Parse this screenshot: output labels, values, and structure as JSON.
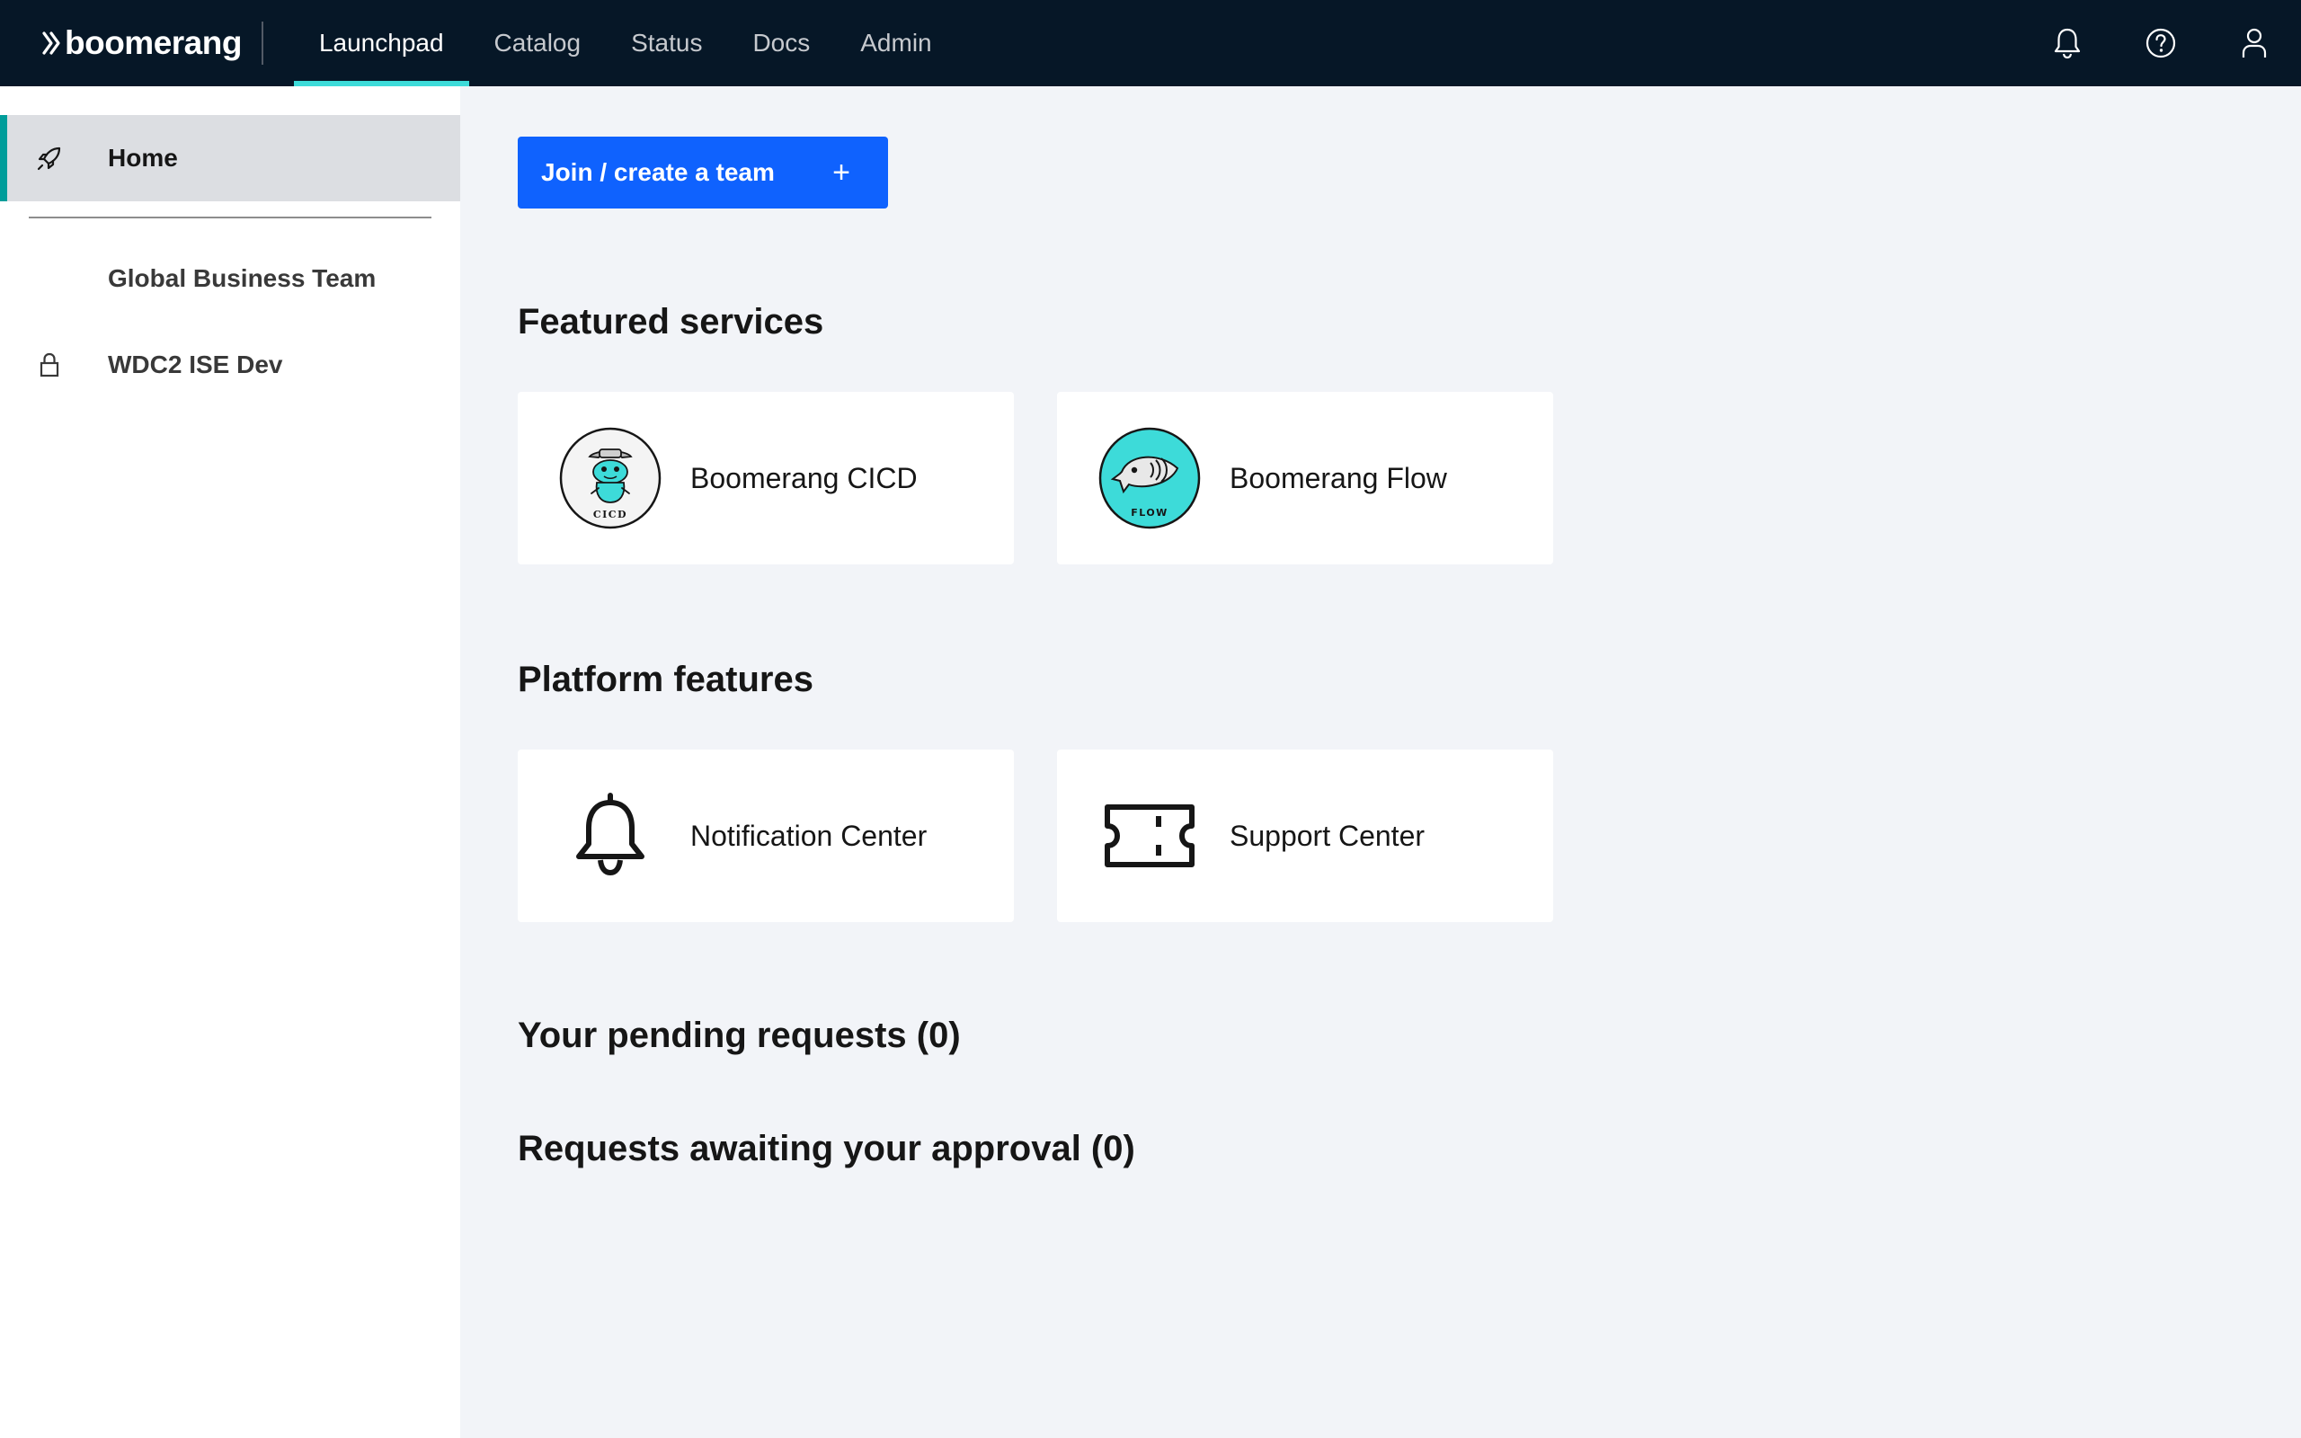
{
  "header": {
    "brand": "boomerang",
    "nav": [
      {
        "label": "Launchpad",
        "active": true
      },
      {
        "label": "Catalog",
        "active": false
      },
      {
        "label": "Status",
        "active": false
      },
      {
        "label": "Docs",
        "active": false
      },
      {
        "label": "Admin",
        "active": false
      }
    ],
    "actions": [
      "bell-icon",
      "help-icon",
      "user-icon"
    ]
  },
  "sidebar": {
    "items": [
      {
        "label": "Home",
        "icon": "rocket-icon",
        "active": true
      },
      {
        "label": "Global Business Team",
        "icon": null
      },
      {
        "label": "WDC2 ISE Dev",
        "icon": "lock-icon"
      }
    ]
  },
  "main": {
    "join_button": "Join / create a team",
    "join_button_icon": "plus-icon",
    "featured_title": "Featured services",
    "featured": [
      {
        "label": "Boomerang CICD",
        "badge_text": "CICD",
        "icon": "cicd-logo"
      },
      {
        "label": "Boomerang Flow",
        "badge_text": "FLOW",
        "icon": "flow-logo"
      }
    ],
    "platform_title": "Platform features",
    "platform": [
      {
        "label": "Notification Center",
        "icon": "bell-icon"
      },
      {
        "label": "Support Center",
        "icon": "ticket-icon"
      }
    ],
    "pending_title": "Your pending requests (0)",
    "approval_title": "Requests awaiting your approval (0)"
  },
  "colors": {
    "header_bg": "#061727",
    "active_accent": "#3ddbd9",
    "sidebar_accent": "#009d9a",
    "primary_button": "#0f62fe",
    "page_bg": "#f2f4f8",
    "flow_teal": "#3ddbd9"
  }
}
